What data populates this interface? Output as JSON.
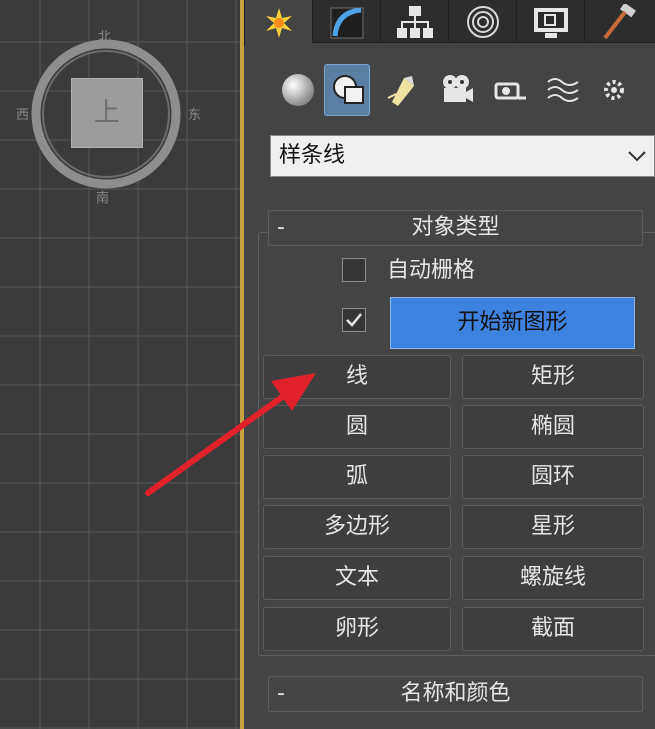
{
  "viewport": {
    "viewcube": {
      "top_label": "上",
      "north": "北",
      "south": "南",
      "west": "西",
      "east": "东"
    }
  },
  "command_panel": {
    "main_tabs": [
      {
        "icon": "create-icon",
        "active": true
      },
      {
        "icon": "modify-icon",
        "active": false
      },
      {
        "icon": "hierarchy-icon",
        "active": false
      },
      {
        "icon": "motion-icon",
        "active": false
      },
      {
        "icon": "display-icon",
        "active": false
      },
      {
        "icon": "utilities-icon",
        "active": false
      }
    ],
    "sub_tabs": [
      {
        "icon": "geometry-icon",
        "active": false
      },
      {
        "icon": "shapes-icon",
        "active": true
      },
      {
        "icon": "lights-icon",
        "active": false
      },
      {
        "icon": "cameras-icon",
        "active": false
      },
      {
        "icon": "helpers-icon",
        "active": false
      },
      {
        "icon": "space-warps-icon",
        "active": false
      },
      {
        "icon": "systems-icon",
        "active": false
      }
    ],
    "category": {
      "value": "样条线"
    },
    "object_type": {
      "toggle": "-",
      "title": "对象类型",
      "auto_grid": {
        "label": "自动栅格",
        "checked": false
      },
      "start_new_shape": {
        "label": "开始新图形",
        "checked": true
      },
      "buttons": {
        "line": "线",
        "rectangle": "矩形",
        "circle": "圆",
        "ellipse": "椭圆",
        "arc": "弧",
        "donut": "圆环",
        "ngon": "多边形",
        "star": "星形",
        "text": "文本",
        "helix": "螺旋线",
        "egg": "卵形",
        "section": "截面"
      }
    },
    "name_and_color": {
      "toggle": "-",
      "title": "名称和颜色"
    }
  },
  "colors": {
    "viewport_bg": "#3b3b3b",
    "grid": "#575757",
    "panel_bg": "#444444",
    "accent_blue": "#3d82de",
    "annotation_arrow": "#e0202a",
    "viewport_border": "#c9a240"
  }
}
